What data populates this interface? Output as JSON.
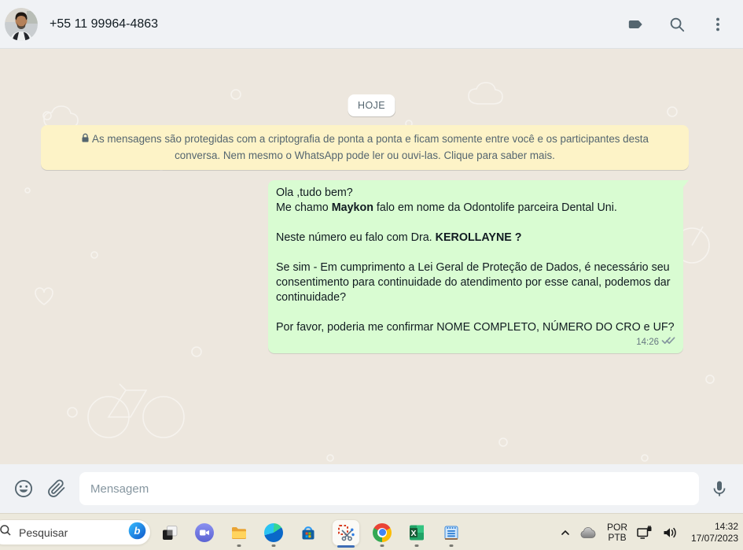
{
  "header": {
    "contact_name": "+55 11 99964-4863",
    "icons": [
      "label-icon",
      "search-icon",
      "kebab-menu-icon"
    ]
  },
  "chat": {
    "date_divider": "HOJE",
    "encryption_notice": "As mensagens são protegidas com a criptografia de ponta a ponta e ficam somente entre você e os participantes desta conversa. Nem mesmo o WhatsApp pode ler ou ouvi-las. Clique para saber mais.",
    "message": {
      "direction": "outgoing",
      "paragraphs": [
        [
          {
            "t": "Ola ,tudo bem?"
          }
        ],
        [
          {
            "t": "Me chamo "
          },
          {
            "t": "Maykon",
            "b": true
          },
          {
            "t": " falo em nome da Odontolife parceira Dental Uni."
          }
        ],
        [],
        [
          {
            "t": "Neste número eu falo com Dra. "
          },
          {
            "t": "KEROLLAYNE ?",
            "b": true
          }
        ],
        [],
        [
          {
            "t": "Se sim - Em cumprimento a Lei Geral de Proteção de Dados, é necessário seu consentimento para continuidade do atendimento por esse canal, podemos dar continuidade?"
          }
        ],
        [],
        [
          {
            "t": "Por favor, poderia me confirmar NOME COMPLETO, NÚMERO DO CRO e UF?"
          }
        ]
      ],
      "time": "14:26",
      "status": "delivered-double-check"
    }
  },
  "composer": {
    "placeholder": "Mensagem",
    "icons": [
      "emoji-icon",
      "attach-icon",
      "mic-icon"
    ]
  },
  "taskbar": {
    "search_label": "Pesquisar",
    "apps": [
      {
        "name": "task-view",
        "running": false,
        "active": false
      },
      {
        "name": "teams-chat",
        "running": false,
        "active": false
      },
      {
        "name": "file-explorer",
        "running": true,
        "active": false
      },
      {
        "name": "edge",
        "running": true,
        "active": false
      },
      {
        "name": "microsoft-store",
        "running": false,
        "active": false
      },
      {
        "name": "snipping-tool",
        "running": true,
        "active": true
      },
      {
        "name": "chrome",
        "running": true,
        "active": false
      },
      {
        "name": "excel",
        "running": true,
        "active": false
      },
      {
        "name": "notepad",
        "running": true,
        "active": false
      }
    ],
    "tray": {
      "language": [
        "POR",
        "PTB"
      ],
      "time": "14:32",
      "date": "17/07/2023"
    }
  },
  "colors": {
    "outgoing_bubble": "#d9fcd2",
    "notice_bg": "#fdf3c7",
    "chat_bg": "#ede7de",
    "bars_bg": "#f0f2f5",
    "taskbar_bg": "#ece9dc",
    "icon": "#54656f",
    "active_indicator": "#3e6db5"
  }
}
